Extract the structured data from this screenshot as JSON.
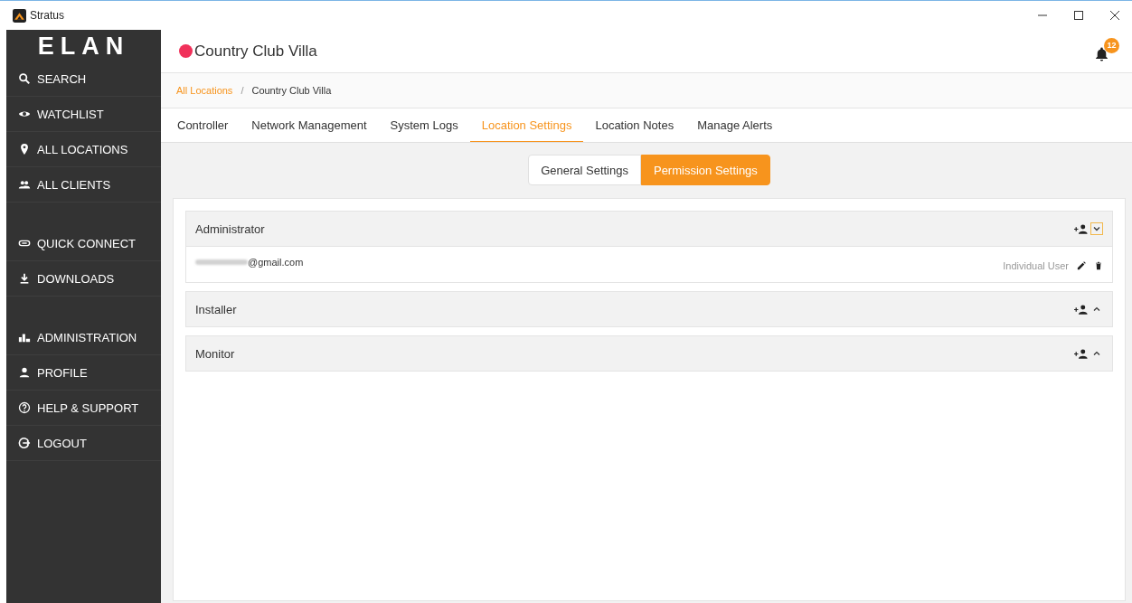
{
  "window": {
    "title": "Stratus"
  },
  "sidebar": {
    "logo": "ELAN",
    "sections": [
      {
        "items": [
          {
            "label": "SEARCH"
          },
          {
            "label": "WATCHLIST"
          },
          {
            "label": "ALL LOCATIONS"
          },
          {
            "label": "ALL CLIENTS"
          }
        ]
      },
      {
        "items": [
          {
            "label": "QUICK CONNECT"
          },
          {
            "label": "DOWNLOADS"
          }
        ]
      },
      {
        "items": [
          {
            "label": "ADMINISTRATION"
          },
          {
            "label": "PROFILE"
          },
          {
            "label": "HELP & SUPPORT"
          },
          {
            "label": "LOGOUT"
          }
        ]
      }
    ]
  },
  "header": {
    "title": "Country Club Villa",
    "status": {
      "color": "#f0315a"
    },
    "notification_count": "12"
  },
  "breadcrumb": {
    "separator": "/",
    "items": [
      {
        "label": "All Locations"
      },
      {
        "label": "Country Club Villa"
      }
    ]
  },
  "tabs": [
    {
      "label": "Controller",
      "selected": false
    },
    {
      "label": "Network Management",
      "selected": false
    },
    {
      "label": "System Logs",
      "selected": false
    },
    {
      "label": "Location Settings",
      "selected": true
    },
    {
      "label": "Location Notes",
      "selected": false
    },
    {
      "label": "Manage Alerts",
      "selected": false
    }
  ],
  "segments": [
    {
      "label": "General Settings",
      "selected": false
    },
    {
      "label": "Permission Settings",
      "selected": true
    }
  ],
  "groups": [
    {
      "name": "Administrator",
      "expanded": true,
      "users": [
        {
          "email": "@gmail.com",
          "type": "Individual User"
        }
      ]
    },
    {
      "name": "Installer",
      "expanded": false
    },
    {
      "name": "Monitor",
      "expanded": false
    }
  ]
}
